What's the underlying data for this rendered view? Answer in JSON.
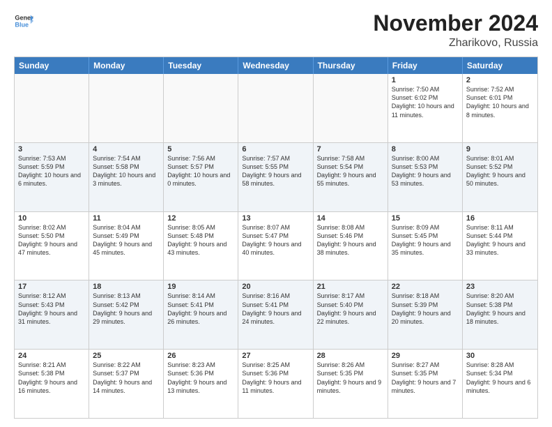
{
  "logo": {
    "general": "General",
    "blue": "Blue"
  },
  "header": {
    "month": "November 2024",
    "location": "Zharikovo, Russia"
  },
  "days_of_week": [
    "Sunday",
    "Monday",
    "Tuesday",
    "Wednesday",
    "Thursday",
    "Friday",
    "Saturday"
  ],
  "weeks": [
    [
      {
        "day": "",
        "info": ""
      },
      {
        "day": "",
        "info": ""
      },
      {
        "day": "",
        "info": ""
      },
      {
        "day": "",
        "info": ""
      },
      {
        "day": "",
        "info": ""
      },
      {
        "day": "1",
        "info": "Sunrise: 7:50 AM\nSunset: 6:02 PM\nDaylight: 10 hours and 11 minutes."
      },
      {
        "day": "2",
        "info": "Sunrise: 7:52 AM\nSunset: 6:01 PM\nDaylight: 10 hours and 8 minutes."
      }
    ],
    [
      {
        "day": "3",
        "info": "Sunrise: 7:53 AM\nSunset: 5:59 PM\nDaylight: 10 hours and 6 minutes."
      },
      {
        "day": "4",
        "info": "Sunrise: 7:54 AM\nSunset: 5:58 PM\nDaylight: 10 hours and 3 minutes."
      },
      {
        "day": "5",
        "info": "Sunrise: 7:56 AM\nSunset: 5:57 PM\nDaylight: 10 hours and 0 minutes."
      },
      {
        "day": "6",
        "info": "Sunrise: 7:57 AM\nSunset: 5:55 PM\nDaylight: 9 hours and 58 minutes."
      },
      {
        "day": "7",
        "info": "Sunrise: 7:58 AM\nSunset: 5:54 PM\nDaylight: 9 hours and 55 minutes."
      },
      {
        "day": "8",
        "info": "Sunrise: 8:00 AM\nSunset: 5:53 PM\nDaylight: 9 hours and 53 minutes."
      },
      {
        "day": "9",
        "info": "Sunrise: 8:01 AM\nSunset: 5:52 PM\nDaylight: 9 hours and 50 minutes."
      }
    ],
    [
      {
        "day": "10",
        "info": "Sunrise: 8:02 AM\nSunset: 5:50 PM\nDaylight: 9 hours and 47 minutes."
      },
      {
        "day": "11",
        "info": "Sunrise: 8:04 AM\nSunset: 5:49 PM\nDaylight: 9 hours and 45 minutes."
      },
      {
        "day": "12",
        "info": "Sunrise: 8:05 AM\nSunset: 5:48 PM\nDaylight: 9 hours and 43 minutes."
      },
      {
        "day": "13",
        "info": "Sunrise: 8:07 AM\nSunset: 5:47 PM\nDaylight: 9 hours and 40 minutes."
      },
      {
        "day": "14",
        "info": "Sunrise: 8:08 AM\nSunset: 5:46 PM\nDaylight: 9 hours and 38 minutes."
      },
      {
        "day": "15",
        "info": "Sunrise: 8:09 AM\nSunset: 5:45 PM\nDaylight: 9 hours and 35 minutes."
      },
      {
        "day": "16",
        "info": "Sunrise: 8:11 AM\nSunset: 5:44 PM\nDaylight: 9 hours and 33 minutes."
      }
    ],
    [
      {
        "day": "17",
        "info": "Sunrise: 8:12 AM\nSunset: 5:43 PM\nDaylight: 9 hours and 31 minutes."
      },
      {
        "day": "18",
        "info": "Sunrise: 8:13 AM\nSunset: 5:42 PM\nDaylight: 9 hours and 29 minutes."
      },
      {
        "day": "19",
        "info": "Sunrise: 8:14 AM\nSunset: 5:41 PM\nDaylight: 9 hours and 26 minutes."
      },
      {
        "day": "20",
        "info": "Sunrise: 8:16 AM\nSunset: 5:41 PM\nDaylight: 9 hours and 24 minutes."
      },
      {
        "day": "21",
        "info": "Sunrise: 8:17 AM\nSunset: 5:40 PM\nDaylight: 9 hours and 22 minutes."
      },
      {
        "day": "22",
        "info": "Sunrise: 8:18 AM\nSunset: 5:39 PM\nDaylight: 9 hours and 20 minutes."
      },
      {
        "day": "23",
        "info": "Sunrise: 8:20 AM\nSunset: 5:38 PM\nDaylight: 9 hours and 18 minutes."
      }
    ],
    [
      {
        "day": "24",
        "info": "Sunrise: 8:21 AM\nSunset: 5:38 PM\nDaylight: 9 hours and 16 minutes."
      },
      {
        "day": "25",
        "info": "Sunrise: 8:22 AM\nSunset: 5:37 PM\nDaylight: 9 hours and 14 minutes."
      },
      {
        "day": "26",
        "info": "Sunrise: 8:23 AM\nSunset: 5:36 PM\nDaylight: 9 hours and 13 minutes."
      },
      {
        "day": "27",
        "info": "Sunrise: 8:25 AM\nSunset: 5:36 PM\nDaylight: 9 hours and 11 minutes."
      },
      {
        "day": "28",
        "info": "Sunrise: 8:26 AM\nSunset: 5:35 PM\nDaylight: 9 hours and 9 minutes."
      },
      {
        "day": "29",
        "info": "Sunrise: 8:27 AM\nSunset: 5:35 PM\nDaylight: 9 hours and 7 minutes."
      },
      {
        "day": "30",
        "info": "Sunrise: 8:28 AM\nSunset: 5:34 PM\nDaylight: 9 hours and 6 minutes."
      }
    ]
  ]
}
